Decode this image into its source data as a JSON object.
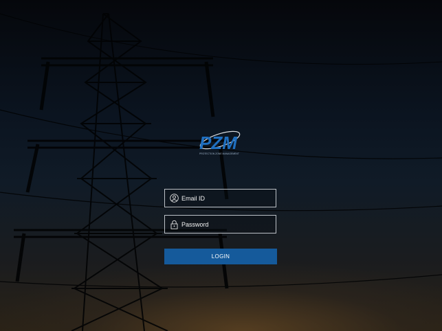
{
  "logo": {
    "text": "PZM",
    "tagline": "PROTECTION ZONE MANAGEMENT",
    "color": "#1f6fc0"
  },
  "login_form": {
    "email_placeholder": "Email ID",
    "email_icon": "user-icon",
    "password_placeholder": "Password",
    "password_icon": "lock-icon",
    "login_label": "LOGIN",
    "button_color": "#155a9b"
  }
}
